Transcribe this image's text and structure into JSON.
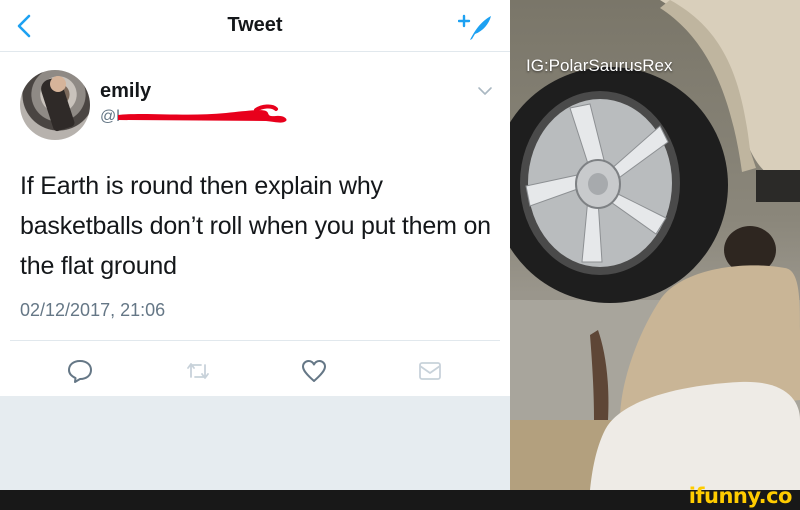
{
  "nav": {
    "title": "Tweet",
    "back_icon": "chevron-left-icon",
    "compose_icon": "compose-feather-icon"
  },
  "author": {
    "name": "emily",
    "handle": "@l"
  },
  "tweet": {
    "text": "If Earth is round then explain why basketballs don’t roll when you put them on the flat ground",
    "timestamp": "02/12/2017, 21:06"
  },
  "actions": [
    "reply-icon",
    "retweet-icon",
    "like-icon",
    "direct-message-icon"
  ],
  "photo": {
    "watermark": "IG:PolarSaurusRex"
  },
  "footer": {
    "brand": "ifunny.co"
  },
  "colors": {
    "accent": "#1da1f2",
    "text": "#14171a",
    "muted": "#657786",
    "redaction": "#e8001c",
    "brand": "#ffcc00"
  }
}
